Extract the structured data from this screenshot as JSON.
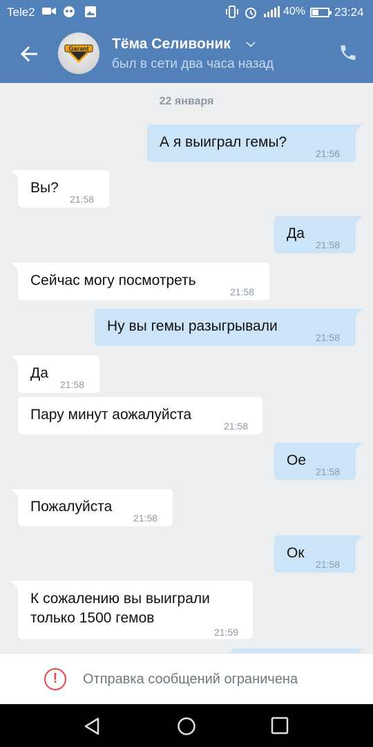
{
  "status_bar": {
    "carrier": "Tele2",
    "battery_percent": "40%",
    "battery_level": 0.4,
    "time": "23:24",
    "icons": [
      "video-icon",
      "game-icon",
      "image-icon",
      "vibrate-icon",
      "alarm-icon",
      "signal-icon",
      "battery-icon"
    ]
  },
  "header": {
    "contact_name": "Тёма Селивоник",
    "last_seen": "был в сети два часа назад",
    "avatar_text": "Garant"
  },
  "chat": {
    "date": "22 января",
    "messages": [
      {
        "dir": "out",
        "text": "А я выиграл гемы?",
        "time": "21:56"
      },
      {
        "dir": "in",
        "text": "Вы?",
        "time": "21:58"
      },
      {
        "dir": "out",
        "text": "Да",
        "time": "21:58"
      },
      {
        "dir": "in",
        "text": "Сейчас могу посмотреть",
        "time": "21:58"
      },
      {
        "dir": "out",
        "text": "Ну вы гемы разыгрывали",
        "time": "21:58"
      },
      {
        "dir": "in",
        "text": "Да",
        "time": "21:58"
      },
      {
        "dir": "in",
        "text": "Пару минут аожалуйста",
        "time": "21:58"
      },
      {
        "dir": "out",
        "text": "Ое",
        "time": "21:58"
      },
      {
        "dir": "in",
        "text": "Пожалуйста",
        "time": "21:58"
      },
      {
        "dir": "out",
        "text": "Ок",
        "time": "21:58"
      },
      {
        "dir": "in",
        "text": "К сожалению вы выиграли",
        "text2": "только 1500 гемов",
        "time": "21:59"
      }
    ]
  },
  "footer": {
    "restriction_text": "Отправка сообщений ограничена"
  },
  "colors": {
    "header": "#5181b8",
    "outgoing_bubble": "#cce4f7",
    "incoming_bubble": "#ffffff",
    "background": "#edeef0",
    "warning": "#e64646"
  }
}
